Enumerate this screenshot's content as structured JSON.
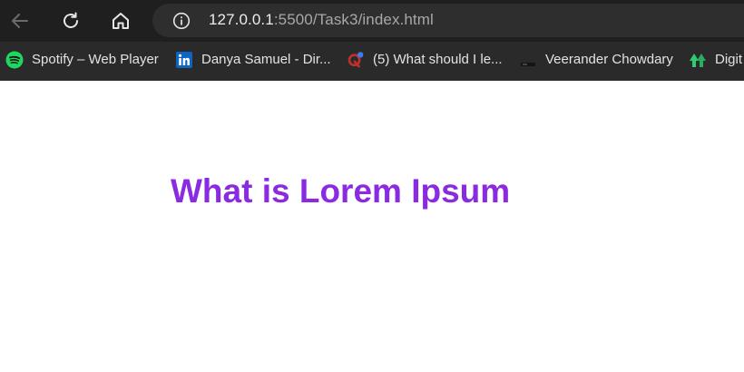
{
  "browser": {
    "address_bar": {
      "url_host": "127.0.0.1",
      "url_rest": ":5500/Task3/index.html"
    },
    "bookmarks": [
      {
        "label": "Spotify – Web Player",
        "icon": "spotify-icon"
      },
      {
        "label": "Danya Samuel - Dir...",
        "icon": "linkedin-icon"
      },
      {
        "label": "(5) What should I le...",
        "icon": "quora-icon"
      },
      {
        "label": "Veerander Chowdary",
        "icon": "dark-page-icon"
      },
      {
        "label": "Digit",
        "icon": "green-arrows-icon"
      }
    ]
  },
  "page": {
    "heading": "What is Lorem Ipsum",
    "heading_color": "#8a2be2"
  },
  "colors": {
    "toolbar": "#1f1f1f",
    "bookmarks_bar": "#2a2a2a",
    "spotify": "#1ed760",
    "linkedin": "#0a66c2",
    "quora": "#b92b27",
    "digit": "#2ecc71"
  }
}
